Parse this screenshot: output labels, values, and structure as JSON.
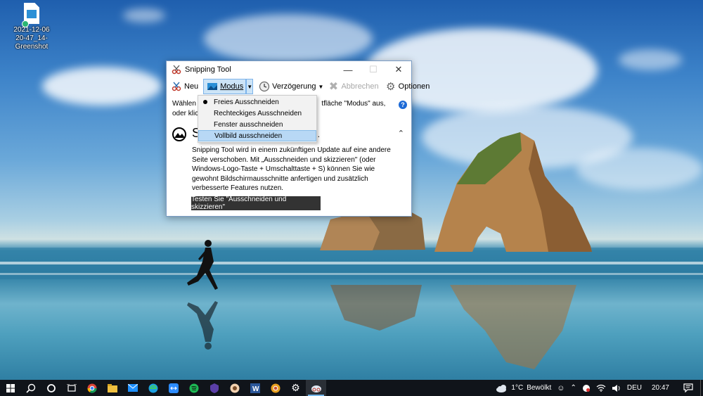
{
  "desktop": {
    "icon": {
      "label_line1": "2021-12-06",
      "label_line2": "20-47_14-Greenshot"
    }
  },
  "snipping_tool": {
    "title": "Snipping Tool",
    "toolbar": {
      "new_label": "Neu",
      "mode_label": "Modus",
      "delay_label": "Verzögerung",
      "cancel_label": "Abbrechen",
      "options_label": "Optionen"
    },
    "instructions_line1_start": "Wählen S",
    "instructions_line1_end": "tfläche \"Modus\" aus,",
    "instructions_line2": "oder klic",
    "info": {
      "heading_start": "S",
      "heading_end": "...",
      "body": "Snipping Tool wird in einem zukünftigen Update auf eine andere Seite verschoben. Mit „Ausschneiden und skizzieren\" (oder Windows-Logo-Taste + Umschalttaste + S) können Sie wie gewohnt Bildschirmausschnitte anfertigen und zusätzlich verbesserte Features nutzen.",
      "try_button": "Testen Sie \"Ausschneiden und skizzieren\""
    }
  },
  "mode_menu": {
    "items": [
      {
        "label": "Freies Ausschneiden",
        "selected": true
      },
      {
        "label": "Rechteckiges Ausschneiden",
        "selected": false
      },
      {
        "label": "Fenster ausschneiden",
        "selected": false
      },
      {
        "label": "Vollbild ausschneiden",
        "selected": false,
        "highlighted": true
      }
    ]
  },
  "taskbar": {
    "weather": {
      "temp": "1°C",
      "condition": "Bewölkt"
    },
    "language": "DEU",
    "time": "20:47",
    "colors": {
      "background": "#10141a",
      "accent": "#76b9ed"
    }
  }
}
